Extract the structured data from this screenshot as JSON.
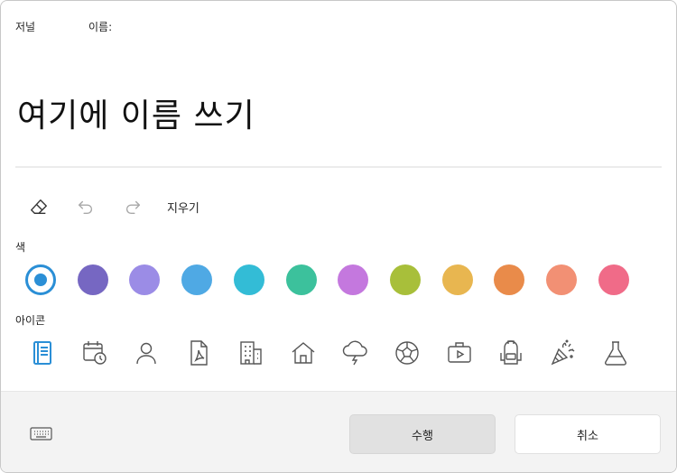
{
  "header": {
    "label_type": "저널",
    "label_name": "이름:"
  },
  "name_field": {
    "value": "여기에 이름 쓰기"
  },
  "toolbar": {
    "clear_label": "지우기"
  },
  "sections": {
    "color_label": "색",
    "icon_label": "아이콘"
  },
  "colors": {
    "selected_index": 0,
    "swatches": [
      "#2b8fd6",
      "#7667c2",
      "#9b8ce6",
      "#4fa9e4",
      "#33bcd6",
      "#3cc19c",
      "#c478de",
      "#a8bf3a",
      "#e8b650",
      "#e98b4a",
      "#f29074",
      "#f06b88"
    ]
  },
  "icons": [
    "notebook-icon",
    "calendar-clock-icon",
    "person-icon",
    "pdf-document-icon",
    "building-icon",
    "home-icon",
    "storm-cloud-icon",
    "soccer-ball-icon",
    "suitcase-video-icon",
    "backpack-icon",
    "party-popper-icon",
    "flask-icon"
  ],
  "footer": {
    "ok_label": "수행",
    "cancel_label": "취소"
  },
  "accent_color": "#2b8fd6"
}
